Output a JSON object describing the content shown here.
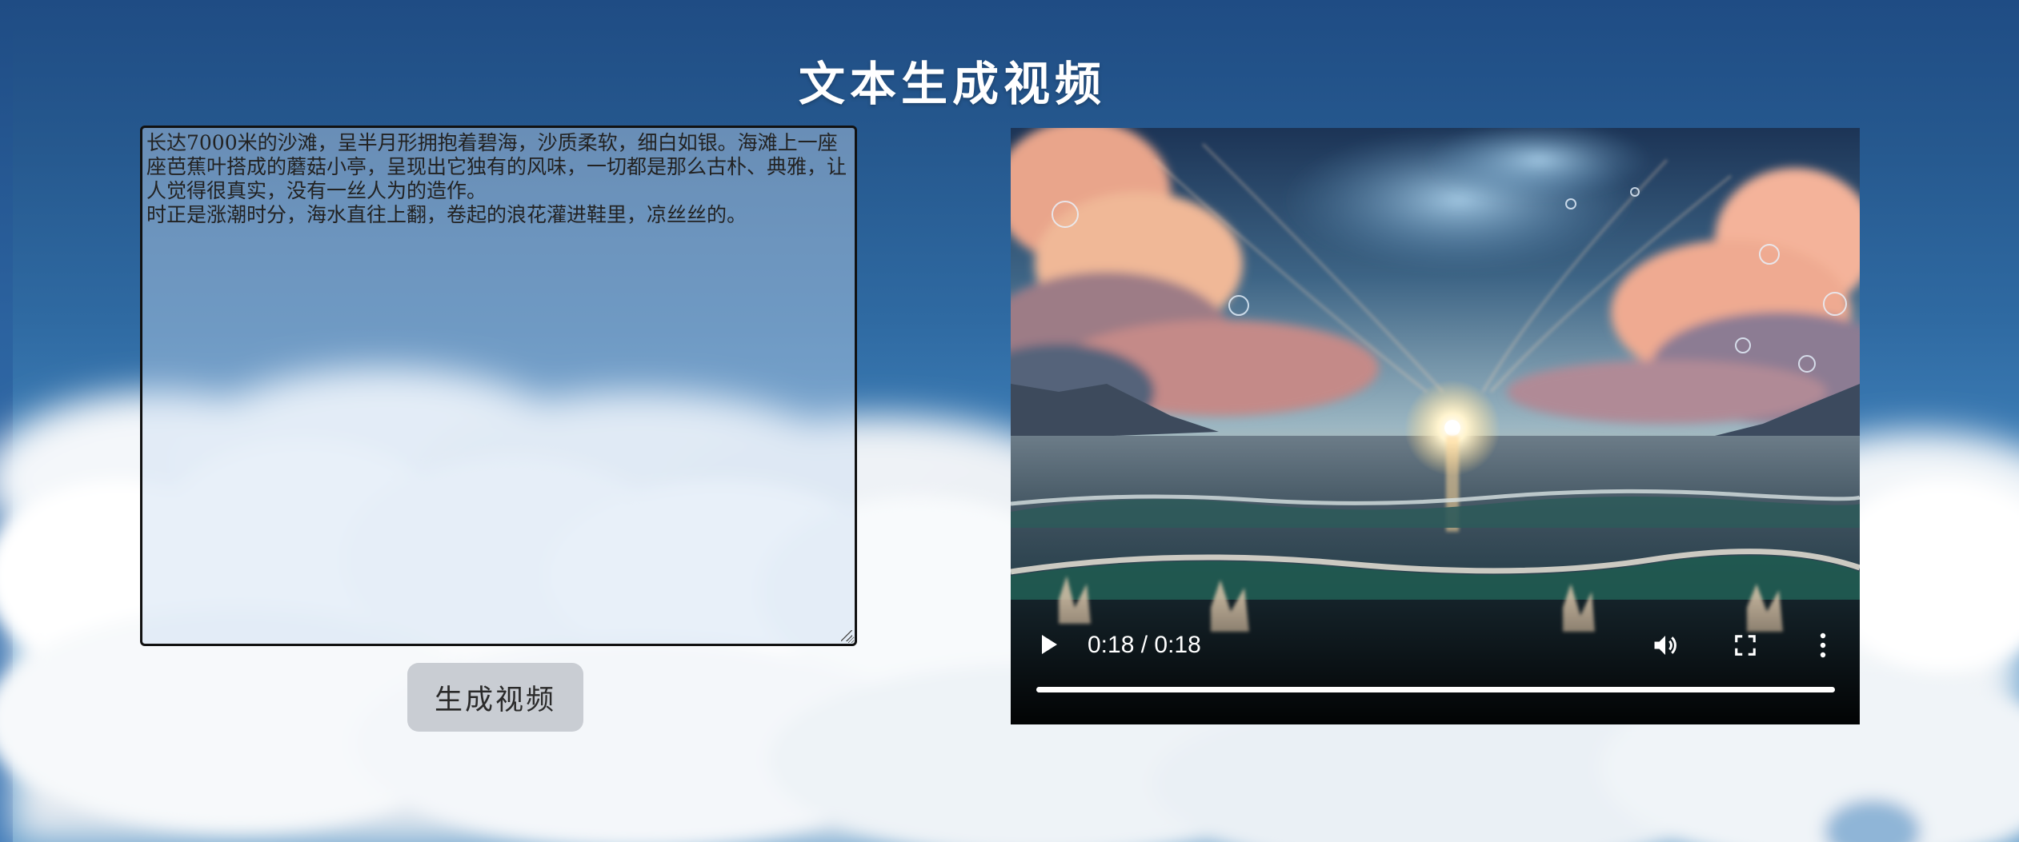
{
  "page": {
    "title": "文本生成视频"
  },
  "prompt": {
    "value": "长达7000米的沙滩，呈半月形拥抱着碧海，沙质柔软，细白如银。海滩上一座座芭蕉叶搭成的蘑菇小亭，呈现出它独有的风味，一切都是那么古朴、典雅，让人觉得很真实，没有一丝人为的造作。\n时正是涨潮时分，海水直往上翻，卷起的浪花灌进鞋里，凉丝丝的。"
  },
  "generate_button": {
    "label": "生成视频"
  },
  "video": {
    "time_display": "0:18 / 0:18",
    "progress": 1.0,
    "icons": {
      "play": "play-icon",
      "volume": "volume-icon",
      "fullscreen": "fullscreen-icon",
      "more": "more-vert-icon"
    }
  },
  "colors": {
    "sky_top": "#1f4c84",
    "button_bg": "#c9cdd3",
    "text_area_border": "#111111"
  }
}
